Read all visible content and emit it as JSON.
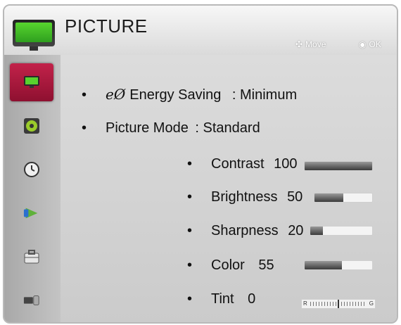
{
  "header": {
    "title": "PICTURE",
    "hints": [
      {
        "glyph": "✣",
        "label": "Move"
      },
      {
        "glyph": "◉",
        "label": "OK"
      }
    ]
  },
  "sidebar": {
    "items": [
      {
        "icon": "picture-icon",
        "active": true
      },
      {
        "icon": "audio-icon",
        "active": false
      },
      {
        "icon": "time-icon",
        "active": false
      },
      {
        "icon": "network-icon",
        "active": false
      },
      {
        "icon": "option-icon",
        "active": false
      },
      {
        "icon": "input-icon",
        "active": false
      }
    ]
  },
  "settings": {
    "energy_saving": {
      "eco_glyph": "eØ",
      "label": "Energy Saving",
      "sep": ":",
      "value": "Minimum"
    },
    "picture_mode": {
      "label": "Picture Mode",
      "sep": ":",
      "value": "Standard"
    }
  },
  "adjustments": [
    {
      "label": "Contrast",
      "value": "100",
      "level": 1.0
    },
    {
      "label": "Brightness",
      "value": "50",
      "level": 0.5
    },
    {
      "label": "Sharpness",
      "value": "20",
      "level": 0.2
    },
    {
      "label": "Color",
      "value": "55",
      "level": 0.55
    }
  ],
  "tint": {
    "label": "Tint",
    "value": "0",
    "left": "R",
    "right": "G"
  },
  "bullet": "•"
}
